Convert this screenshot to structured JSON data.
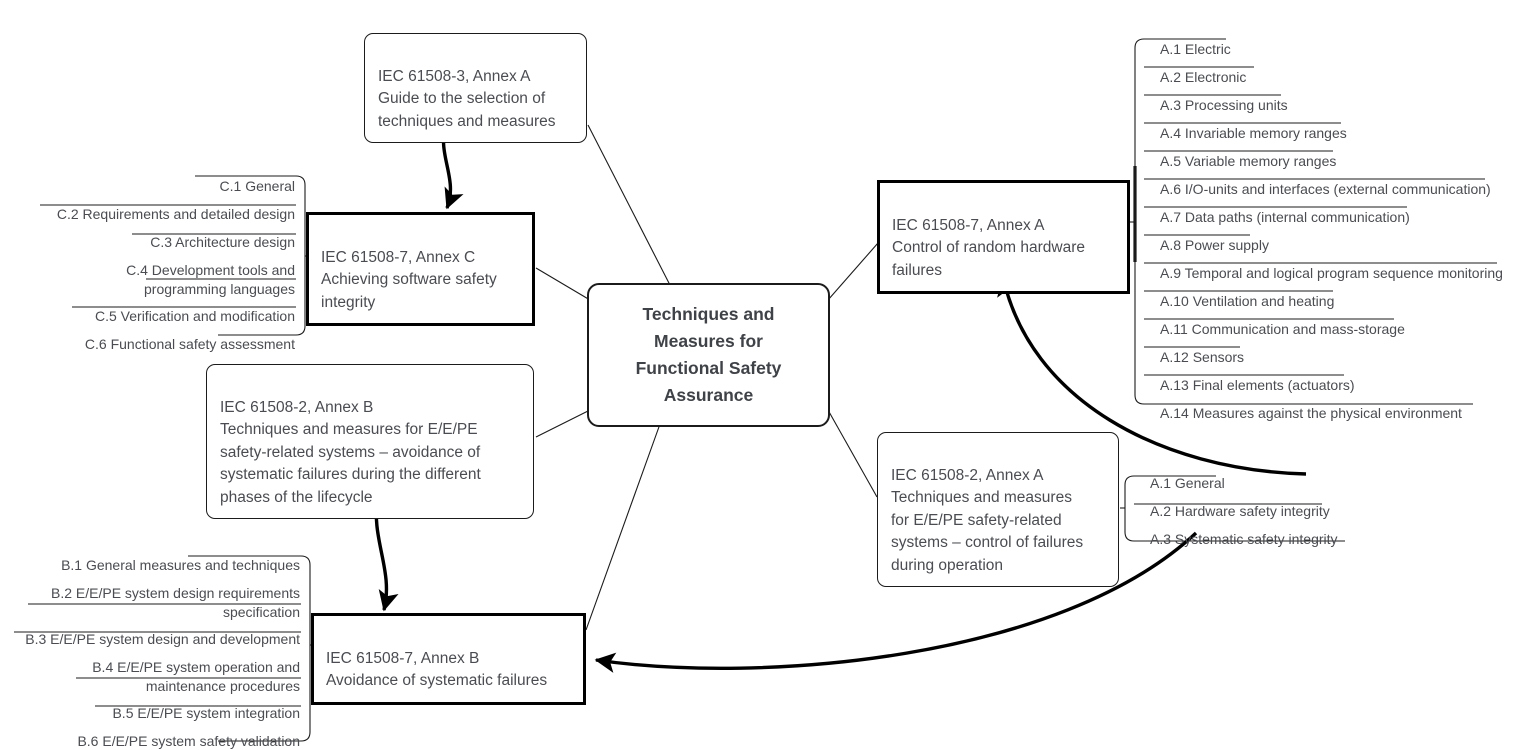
{
  "root": {
    "label": "Techniques and\nMeasures for\nFunctional Safety\nAssurance"
  },
  "nodes": {
    "iec3_annexA": "IEC 61508-3, Annex A\nGuide to the selection of\ntechniques and measures",
    "iec7_annexC": "IEC 61508-7, Annex C\nAchieving software safety\nintegrity",
    "iec2_annexB": "IEC 61508-2, Annex B\nTechniques and measures for E/E/PE\nsafety-related systems – avoidance of\nsystematic failures during the different\nphases of the lifecycle",
    "iec7_annexB": "IEC 61508-7, Annex B\nAvoidance of systematic failures",
    "iec7_annexA": "IEC 61508-7, Annex A\nControl of random hardware\nfailures",
    "iec2_annexA": "IEC 61508-2, Annex A\nTechniques and measures\nfor E/E/PE safety-related\nsystems – control of failures\nduring operation"
  },
  "lists": {
    "annexC_items": [
      "C.1 General",
      "C.2 Requirements and detailed design",
      "C.3 Architecture design",
      "C.4 Development tools and\nprogramming languages",
      "C.5 Verification and modification",
      "C.6 Functional safety assessment"
    ],
    "annexB_items": [
      "B.1 General measures and techniques",
      "B.2 E/E/PE system design requirements\nspecification",
      "B.3 E/E/PE system design and development",
      "B.4 E/E/PE system operation and\nmaintenance procedures",
      "B.5 E/E/PE system integration",
      "B.6 E/E/PE system safety validation"
    ],
    "annexA_hardware_items": [
      "A.1 Electric",
      "A.2 Electronic",
      "A.3 Processing units",
      "A.4 Invariable memory ranges",
      "A.5 Variable memory ranges",
      "A.6 I/O-units and interfaces (external communication)",
      "A.7 Data paths (internal communication)",
      "A.8 Power supply",
      "A.9 Temporal and logical program sequence monitoring",
      "A.10 Ventilation and heating",
      "A.11 Communication and mass-storage",
      "A.12 Sensors",
      "A.13 Final elements (actuators)",
      "A.14 Measures against the physical environment"
    ],
    "annexA_operation_items": [
      "A.1 General",
      "A.2 Hardware safety integrity",
      "A.3 Systematic safety integrity"
    ]
  },
  "colors": {
    "line": "#1b1b1b",
    "text": "#4a4c51",
    "root_text": "#3f4247",
    "background": "#ffffff"
  }
}
